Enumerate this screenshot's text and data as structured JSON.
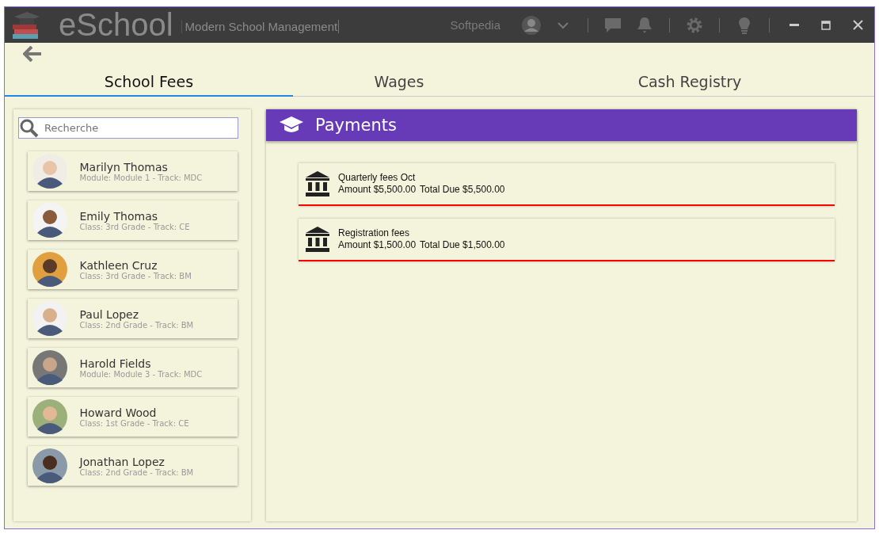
{
  "window": {
    "app_name": "eSchool",
    "subtitle": "Modern School Management",
    "user": "Softpedia"
  },
  "tabs": [
    {
      "label": "School Fees",
      "selected": true
    },
    {
      "label": "Wages",
      "selected": false
    },
    {
      "label": "Cash Registry",
      "selected": false
    }
  ],
  "search": {
    "placeholder": "Recherche"
  },
  "students": [
    {
      "name": "Marilyn Thomas",
      "detail": "Module: Module 1 - Track: MDC"
    },
    {
      "name": "Emily Thomas",
      "detail": "Class: 3rd Grade - Track: CE"
    },
    {
      "name": "Kathleen Cruz",
      "detail": "Class: 3rd Grade - Track: BM"
    },
    {
      "name": "Paul Lopez",
      "detail": "Class: 2nd Grade - Track: BM"
    },
    {
      "name": "Harold Fields",
      "detail": "Module: Module 3 - Track: MDC"
    },
    {
      "name": "Howard Wood",
      "detail": "Class: 1st Grade - Track: CE"
    },
    {
      "name": "Jonathan Lopez",
      "detail": "Class: 2nd Grade - Track: BM"
    }
  ],
  "payments_panel": {
    "title": "Payments"
  },
  "payments": [
    {
      "title": "Quarterly fees Oct",
      "amount": "Amount $5,500.00",
      "total_due": "Total Due $5,500.00"
    },
    {
      "title": "Registration fees",
      "amount": "Amount $1,500.00",
      "total_due": "Total Due $1,500.00"
    }
  ]
}
